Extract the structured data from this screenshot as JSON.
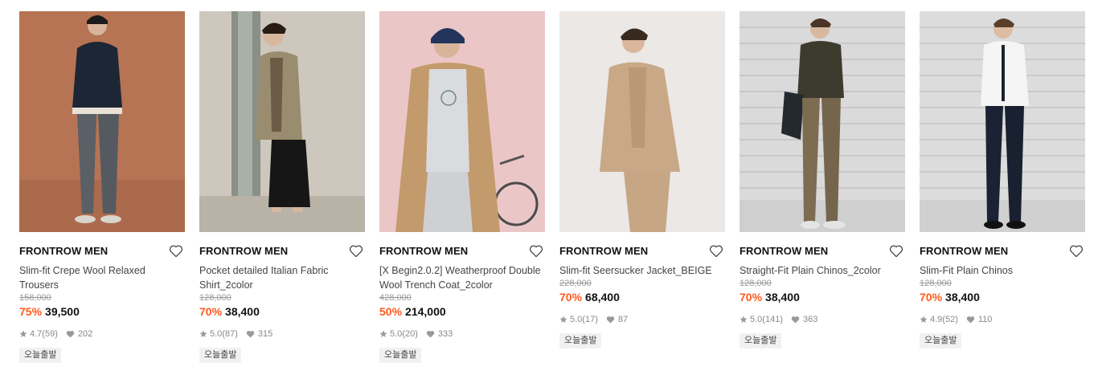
{
  "products": [
    {
      "brand": "FRONTROW MEN",
      "title": "Slim-fit Crepe Wool Relaxed Trousers",
      "original_price": "158,000",
      "discount": "75%",
      "price": "39,500",
      "rating": "4.7",
      "reviews": "(59)",
      "likes": "202",
      "badge": "오늘출발",
      "bg": "#b87556"
    },
    {
      "brand": "FRONTROW MEN",
      "title": "Pocket detailed Italian Fabric Shirt_2color",
      "original_price": "128,000",
      "discount": "70%",
      "price": "38,400",
      "rating": "5.0",
      "reviews": "(87)",
      "likes": "315",
      "badge": "오늘출발",
      "bg": "#c9c3b8"
    },
    {
      "brand": "FRONTROW MEN",
      "title": "[X Begin2.0.2] Weatherproof Double Wool Trench Coat_2color",
      "original_price": "428,000",
      "discount": "50%",
      "price": "214,000",
      "rating": "5.0",
      "reviews": "(20)",
      "likes": "333",
      "badge": "오늘출발",
      "bg": "#e9c4c4"
    },
    {
      "brand": "FRONTROW MEN",
      "title": "Slim-fit Seersucker Jacket_BEIGE",
      "original_price": "228,000",
      "discount": "70%",
      "price": "68,400",
      "rating": "5.0",
      "reviews": "(17)",
      "likes": "87",
      "badge": "오늘출발",
      "bg": "#ece9e6"
    },
    {
      "brand": "FRONTROW MEN",
      "title": "Straight-Fit Plain Chinos_2color",
      "original_price": "128,000",
      "discount": "70%",
      "price": "38,400",
      "rating": "5.0",
      "reviews": "(141)",
      "likes": "363",
      "badge": "오늘출발",
      "bg": "#dcdcdc"
    },
    {
      "brand": "FRONTROW MEN",
      "title": "Slim-Fit Plain Chinos",
      "original_price": "128,000",
      "discount": "70%",
      "price": "38,400",
      "rating": "4.9",
      "reviews": "(52)",
      "likes": "110",
      "badge": "오늘출발",
      "bg": "#dedede"
    }
  ],
  "colors": {
    "discount": "#ff5a1e",
    "badge_bg": "#f1f1f1"
  },
  "icons": {
    "like": "heart-outline-icon",
    "rating": "star-icon",
    "likes_count": "heart-filled-icon"
  }
}
